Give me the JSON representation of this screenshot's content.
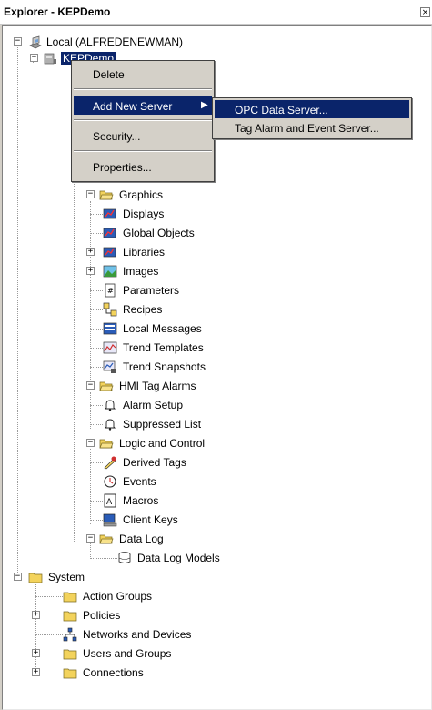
{
  "window": {
    "title": "Explorer - KEPDemo",
    "close_glyph": "×"
  },
  "tree": {
    "root_label": "Local (ALFREDENEWMAN)",
    "app_label": "KEPDemo",
    "graphics": {
      "label": "Graphics",
      "children": [
        "Displays",
        "Global Objects",
        "Libraries",
        "Images",
        "Parameters",
        "Recipes",
        "Local Messages",
        "Trend Templates",
        "Trend Snapshots"
      ]
    },
    "hmi_tag_alarms": {
      "label": "HMI Tag Alarms",
      "children": [
        "Alarm Setup",
        "Suppressed List"
      ]
    },
    "logic_and_control": {
      "label": "Logic and Control",
      "children": [
        "Derived Tags",
        "Events",
        "Macros",
        "Client Keys"
      ]
    },
    "data_log": {
      "label": "Data Log",
      "children": [
        "Data Log Models"
      ]
    },
    "system": {
      "label": "System",
      "children": [
        "Action Groups",
        "Policies",
        "Networks and Devices",
        "Users and Groups",
        "Connections"
      ]
    }
  },
  "context_menu": {
    "items": [
      "Delete",
      "Add New Server",
      "Security...",
      "Properties..."
    ]
  },
  "submenu": {
    "items": [
      "OPC Data Server...",
      "Tag Alarm and Event Server..."
    ]
  },
  "colors": {
    "highlight": "#0a246a",
    "folder": "#f3d35c",
    "menu_bg": "#d4d0c8"
  }
}
